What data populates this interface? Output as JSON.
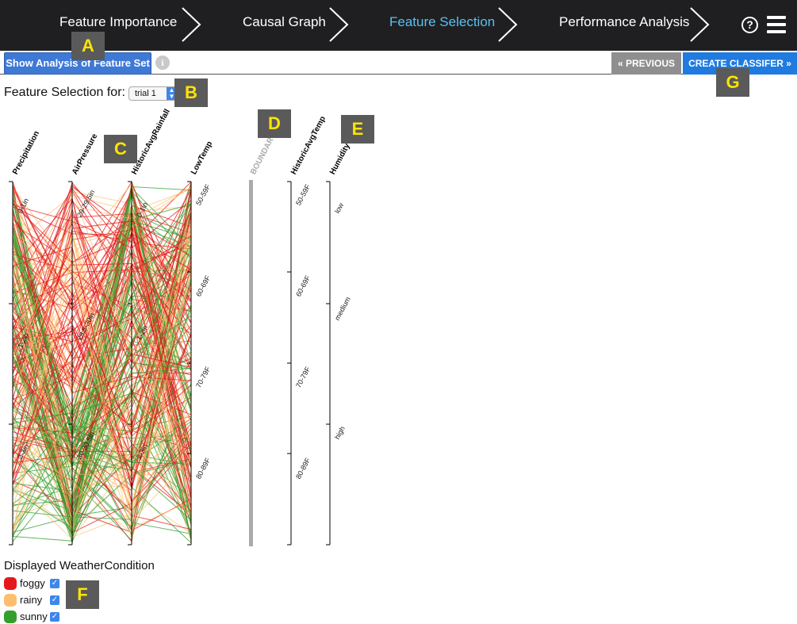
{
  "nav": {
    "steps": [
      {
        "label": "Feature Importance",
        "active": false
      },
      {
        "label": "Causal Graph",
        "active": false
      },
      {
        "label": "Feature Selection",
        "active": true
      },
      {
        "label": "Performance Analysis",
        "active": false
      }
    ],
    "help_icon": "question-circle-icon",
    "menu_icon": "hamburger-menu-icon"
  },
  "toolbar": {
    "analysis_button": "Show Analysis of Feature Set",
    "info_icon": "i",
    "prev_button": "« PREVIOUS",
    "create_button": "CREATE CLASSIFER »"
  },
  "feature_selection": {
    "label": "Feature Selection for:",
    "selected_trial": "trial 1"
  },
  "markers": [
    "A",
    "B",
    "C",
    "D",
    "E",
    "F",
    "G"
  ],
  "axes": [
    {
      "name": "Precipitation",
      "ticks": [
        "0-1in",
        "1-2in",
        "2-3in"
      ]
    },
    {
      "name": "AirPressure",
      "ticks": [
        "29-29.5in",
        "29.5-30in",
        "30-30.5in"
      ]
    },
    {
      "name": "HistoricAvgRainfall",
      "ticks": [
        "0-1in",
        "1-2in",
        "2-3in"
      ]
    },
    {
      "name": "LowTemp",
      "ticks": [
        "50-59F",
        "60-69F",
        "70-79F",
        "80-89F"
      ]
    },
    {
      "name": "BOUNDARY",
      "ticks": []
    },
    {
      "name": "HistoricAvgTemp",
      "ticks": [
        "50-59F",
        "60-69F",
        "70-79F",
        "80-89F"
      ]
    },
    {
      "name": "Humidity",
      "ticks": [
        "low",
        "medium",
        "high"
      ]
    }
  ],
  "legend": {
    "title": "Displayed WeatherCondition",
    "items": [
      {
        "label": "foggy",
        "color": "#e31a1c",
        "checked": true
      },
      {
        "label": "rainy",
        "color": "#fdbf6f",
        "checked": true
      },
      {
        "label": "sunny",
        "color": "#33a02c",
        "checked": true
      }
    ]
  },
  "colors": {
    "nav_bg": "#1f1f22",
    "active_step": "#5bc0ee",
    "primary_button": "#3f79d6",
    "create_button": "#1f7be0",
    "prev_button": "#8f8f8f"
  }
}
